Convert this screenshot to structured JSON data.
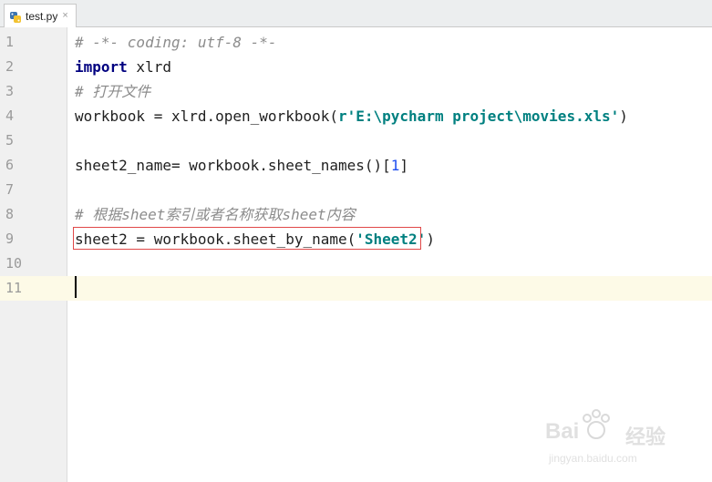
{
  "tab": {
    "filename": "test.py",
    "close_glyph": "×"
  },
  "line_numbers": [
    "1",
    "2",
    "3",
    "4",
    "5",
    "6",
    "7",
    "8",
    "9",
    "10",
    "11"
  ],
  "code": {
    "l1": "# -*- coding: utf-8 -*-",
    "l2_kw": "import",
    "l2_rest": " xlrd",
    "l3": "# 打开文件",
    "l4_pre": "workbook = xlrd.open_workbook(",
    "l4_str": "r'E:\\pycharm project\\movies.xls'",
    "l4_post": ")",
    "l6_pre": "sheet2_name= workbook.sheet_names()[",
    "l6_num": "1",
    "l6_post": "]",
    "l8": "# 根据sheet索引或者名称获取sheet内容",
    "l9_pre": "sheet2 = workbook.sheet_by_name(",
    "l9_str": "'Sheet2'",
    "l9_post": ")"
  },
  "watermark": {
    "brand": "Bai",
    "brand2": "经验",
    "url": "jingyan.baidu.com"
  },
  "colors": {
    "keyword": "#000080",
    "string": "#008080",
    "comment": "#8c8c8c",
    "number": "#1f4ff0",
    "current_line": "#fdfae7",
    "highlight_border": "#e04848"
  }
}
